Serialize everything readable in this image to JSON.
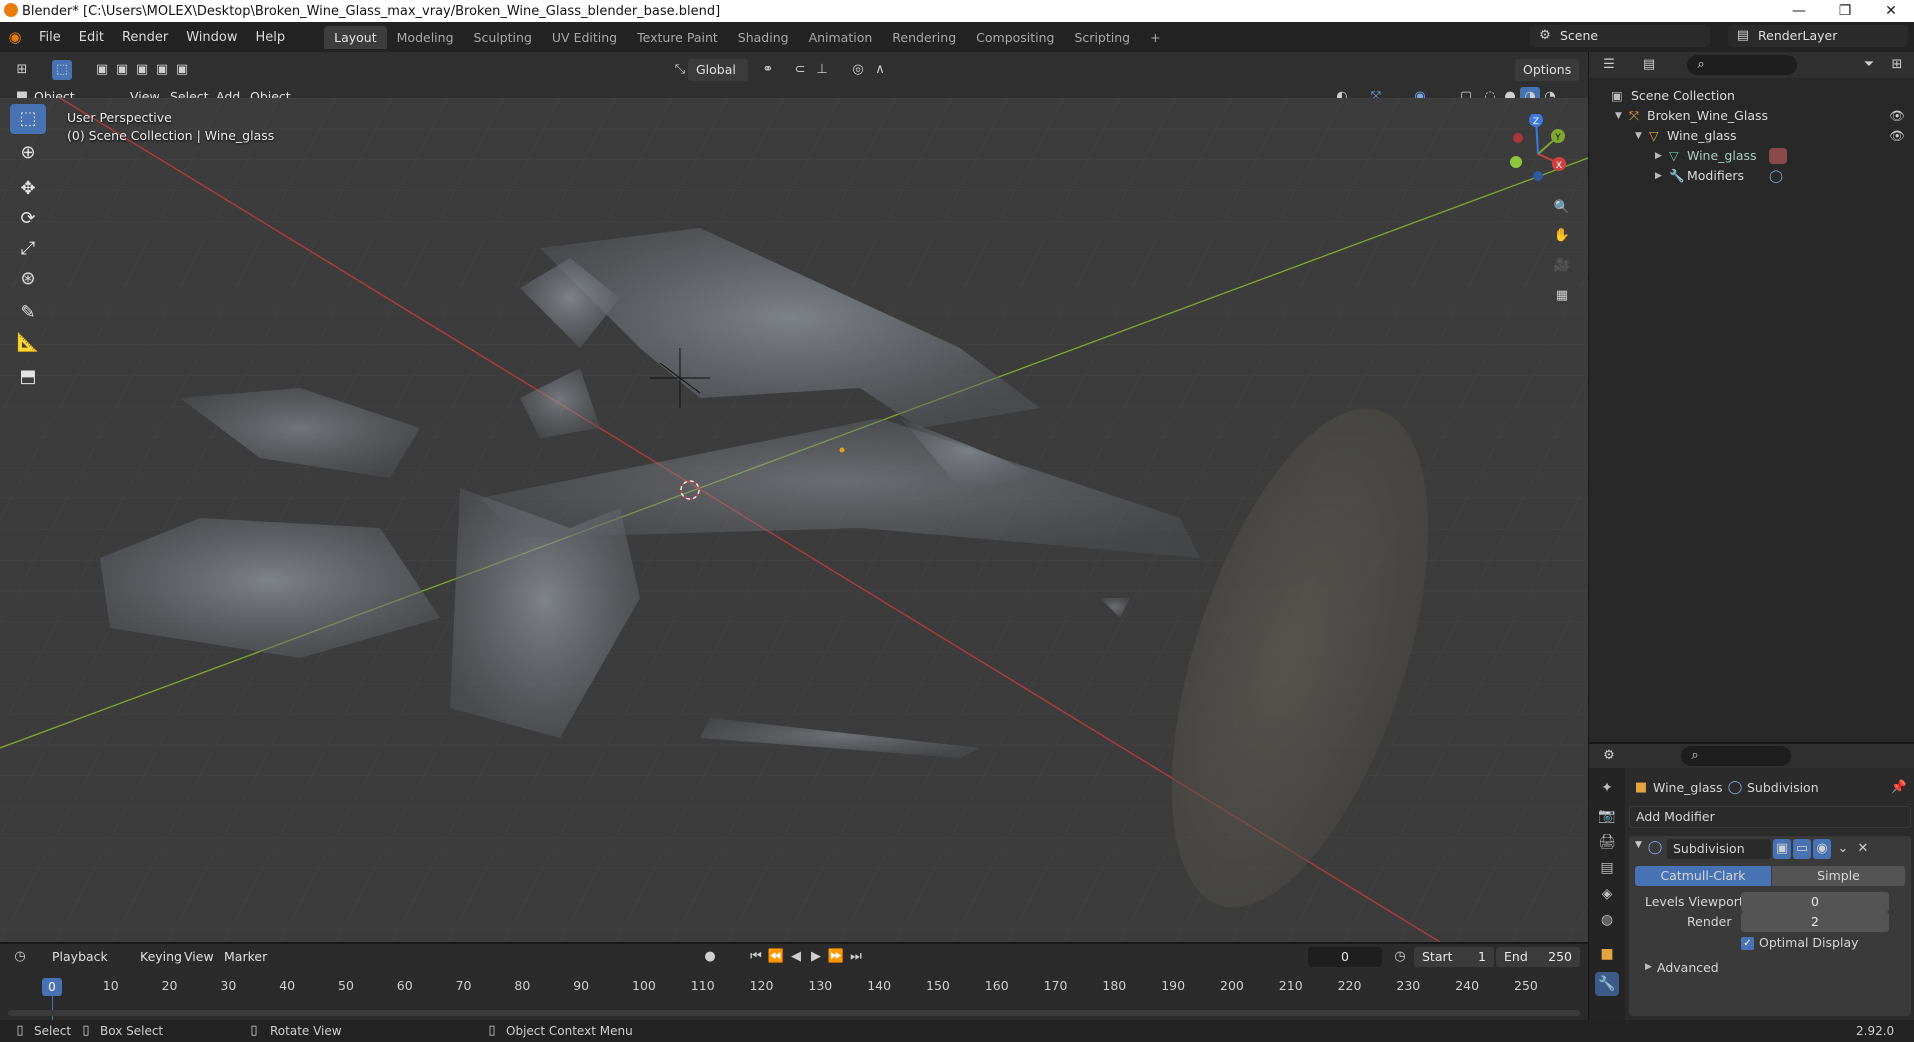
{
  "window": {
    "title": "Blender* [C:\\Users\\MOLEX\\Desktop\\Broken_Wine_Glass_max_vray/Broken_Wine_Glass_blender_base.blend]",
    "minimize": "—",
    "maximize": "❐",
    "close": "✕"
  },
  "menus": [
    "File",
    "Edit",
    "Render",
    "Window",
    "Help"
  ],
  "workspaces": [
    "Layout",
    "Modeling",
    "Sculpting",
    "UV Editing",
    "Texture Paint",
    "Shading",
    "Animation",
    "Rendering",
    "Compositing",
    "Scripting"
  ],
  "add_workspace": "+",
  "scene": {
    "name": "Scene",
    "view_layer": "RenderLayer"
  },
  "viewport_header": {
    "transform_orientation": "Global",
    "options_label": "Options",
    "mode": "Object Mode",
    "menus": [
      "View",
      "Select",
      "Add",
      "Object"
    ]
  },
  "viewport": {
    "perspective_label": "User Perspective",
    "collection_label": "(0) Scene Collection | Wine_glass"
  },
  "gizmo": {
    "x": "X",
    "y": "Y",
    "z": "Z"
  },
  "outliner": {
    "root": "Scene Collection",
    "items": [
      {
        "label": "Broken_Wine_Glass",
        "depth": 1
      },
      {
        "label": "Wine_glass",
        "depth": 2
      },
      {
        "label": "Wine_glass",
        "depth": 3
      },
      {
        "label": "Modifiers",
        "depth": 3
      }
    ]
  },
  "properties": {
    "object_name": "Wine_glass",
    "modifier_breadcrumb": "Subdivision",
    "add_modifier": "Add Modifier",
    "modifier": {
      "name": "Subdivision",
      "type_options": [
        "Catmull-Clark",
        "Simple"
      ],
      "selected_type": "Catmull-Clark",
      "levels_viewport_label": "Levels Viewport",
      "levels_viewport": "0",
      "render_label": "Render",
      "render": "2",
      "optimal_display_label": "Optimal Display",
      "optimal_display": true,
      "advanced_label": "Advanced"
    },
    "version": "2.92.0"
  },
  "timeline": {
    "menus": [
      "Playback",
      "Keying",
      "View",
      "Marker"
    ],
    "current_frame": "0",
    "start_label": "Start",
    "start": "1",
    "end_label": "End",
    "end": "250",
    "ticks": [
      "0",
      "10",
      "20",
      "30",
      "40",
      "50",
      "60",
      "70",
      "80",
      "90",
      "100",
      "110",
      "120",
      "130",
      "140",
      "150",
      "160",
      "170",
      "180",
      "190",
      "200",
      "210",
      "220",
      "230",
      "240",
      "250"
    ]
  },
  "statusbar": {
    "select": "Select",
    "box_select": "Box Select",
    "rotate_view": "Rotate View",
    "context_menu": "Object Context Menu"
  }
}
